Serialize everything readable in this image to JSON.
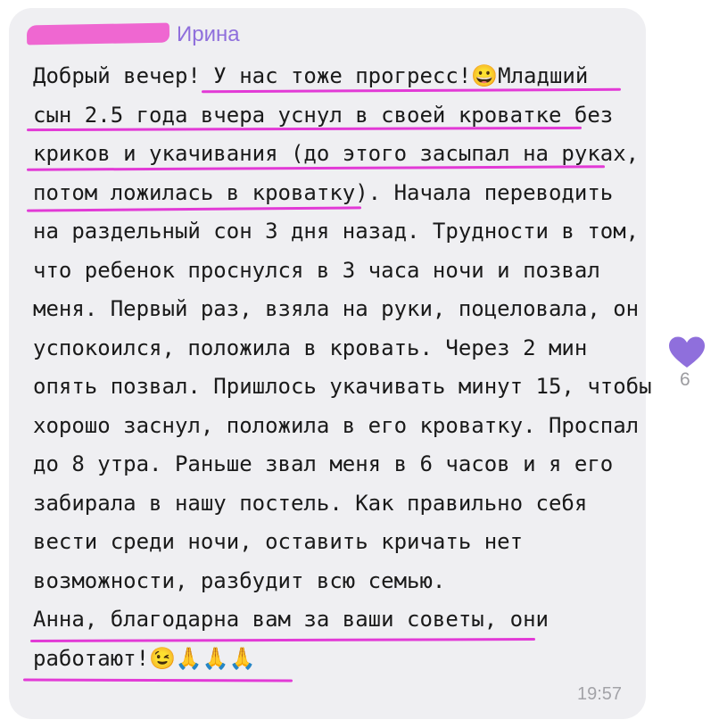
{
  "message": {
    "sender_name": "Ирина",
    "lines": [
      "Добрый вечер! У нас тоже прогресс!😀Младший",
      "сын 2.5 года вчера уснул в своей кроватке без",
      "криков и укачивания (до этого засыпал на руках,",
      "потом ложилась в кроватку). Начала переводить",
      "на раздельный сон 3 дня назад. Трудности в том,",
      "что ребенок проснулся в 3 часа ночи и позвал",
      "меня. Первый раз, взяла на руки, поцеловала, он",
      "успокоился, положила в кровать. Через 2 мин",
      "опять позвал. Пришлось укачивать минут 15, чтобы",
      "хорошо заснул, положила в его кроватку. Проспал",
      "до 8 утра. Раньше звал меня в 6 часов и я его",
      "забирала в нашу постель. Как правильно себя",
      "вести среди ночи, оставить кричать нет",
      "возможности, разбудит всю семью.",
      "Анна, благодарна вам за ваши советы, они",
      "работают!😉🙏🙏🙏"
    ],
    "time": "19:57"
  },
  "reaction": {
    "icon": "heart-icon",
    "count": "6",
    "color": "#8f6fdc"
  },
  "colors": {
    "bubble": "#efeff2",
    "highlight": "#e23ad6",
    "sender": "#8f6fdc"
  }
}
